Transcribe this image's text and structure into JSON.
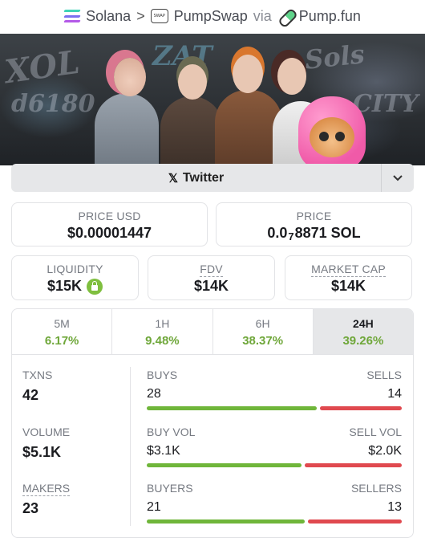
{
  "breadcrumb": {
    "chain": "Solana",
    "separator": ">",
    "dex": "PumpSwap",
    "dex_icon_text": "SWAP",
    "via": "via",
    "launchpad": "Pump.fun"
  },
  "socials": {
    "twitter_label": "Twitter",
    "x_glyph": "𝕏"
  },
  "stats": {
    "price_usd_label": "PRICE USD",
    "price_usd": "$0.00001447",
    "price_label": "PRICE",
    "price_prefix": "0.0",
    "price_subscript": "7",
    "price_suffix": "8871 SOL",
    "liquidity_label": "LIQUIDITY",
    "liquidity": "$15K",
    "fdv_label": "FDV",
    "fdv": "$14K",
    "mcap_label": "MARKET CAP",
    "mcap": "$14K"
  },
  "timeframes": [
    {
      "label": "5M",
      "change": "6.17%",
      "active": false
    },
    {
      "label": "1H",
      "change": "9.48%",
      "active": false
    },
    {
      "label": "6H",
      "change": "38.37%",
      "active": false
    },
    {
      "label": "24H",
      "change": "39.26%",
      "active": true
    }
  ],
  "activity": {
    "txns_label": "TXNS",
    "txns": "42",
    "volume_label": "VOLUME",
    "volume": "$5.1K",
    "makers_label": "MAKERS",
    "makers": "23",
    "buys_label": "BUYS",
    "buys": "28",
    "sells_label": "SELLS",
    "sells": "14",
    "buys_share": 0.667,
    "buyvol_label": "BUY VOL",
    "buyvol": "$3.1K",
    "sellvol_label": "SELL VOL",
    "sellvol": "$2.0K",
    "buyvol_share": 0.608,
    "buyers_label": "BUYERS",
    "buyers": "21",
    "sellers_label": "SELLERS",
    "sellers": "13",
    "buyers_share": 0.618
  },
  "colors": {
    "positive": "#6fa73a",
    "buy_bar": "#6fb63a",
    "sell_bar": "#e0494f"
  }
}
